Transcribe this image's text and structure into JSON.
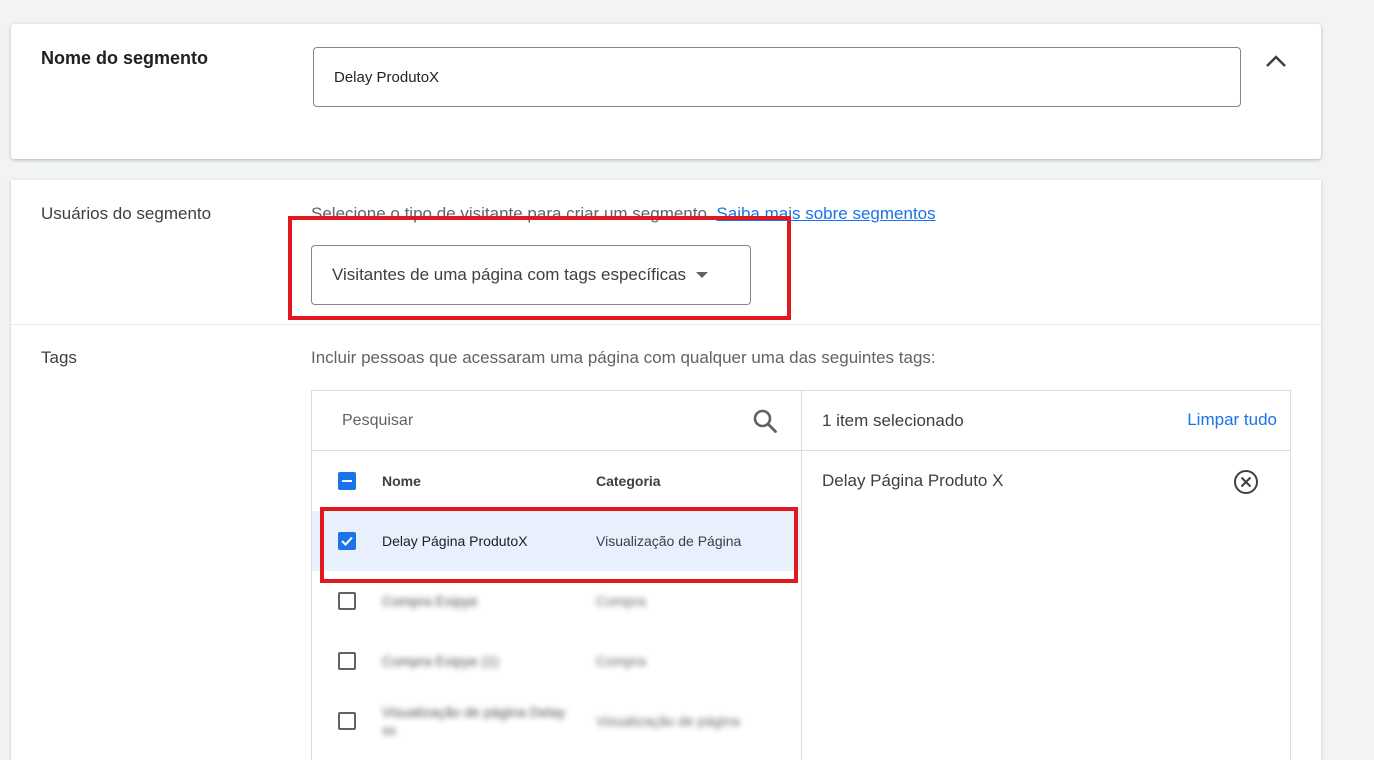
{
  "segment_name": {
    "label": "Nome do segmento",
    "value": "Delay ProdutoX"
  },
  "users": {
    "label": "Usuários do segmento",
    "description": "Selecione o tipo de visitante para criar um segmento.",
    "link": "Saiba mais sobre segmentos",
    "selected_type": "Visitantes de uma página com tags específicas"
  },
  "tags": {
    "label": "Tags",
    "description": "Incluir pessoas que acessaram uma página com qualquer uma das seguintes tags:",
    "search_placeholder": "Pesquisar",
    "columns": {
      "name": "Nome",
      "category": "Categoria"
    },
    "rows": [
      {
        "name": "Delay Página ProdutoX",
        "category": "Visualização de Página",
        "checked": true
      },
      {
        "name": "Compra Exipye",
        "category": "Compra",
        "checked": false
      },
      {
        "name": "Compra Exipye (1)",
        "category": "Compra",
        "checked": false
      },
      {
        "name": "Visualização de página Delay xx",
        "category": "Visualização de página",
        "checked": false
      }
    ],
    "selected_count": "1 item selecionado",
    "clear_all": "Limpar tudo",
    "selected_items": [
      "Delay Página Produto X"
    ]
  },
  "colors": {
    "accent": "#1a73e8",
    "highlight": "#e0191f",
    "selected_row": "#e8f0fe"
  }
}
